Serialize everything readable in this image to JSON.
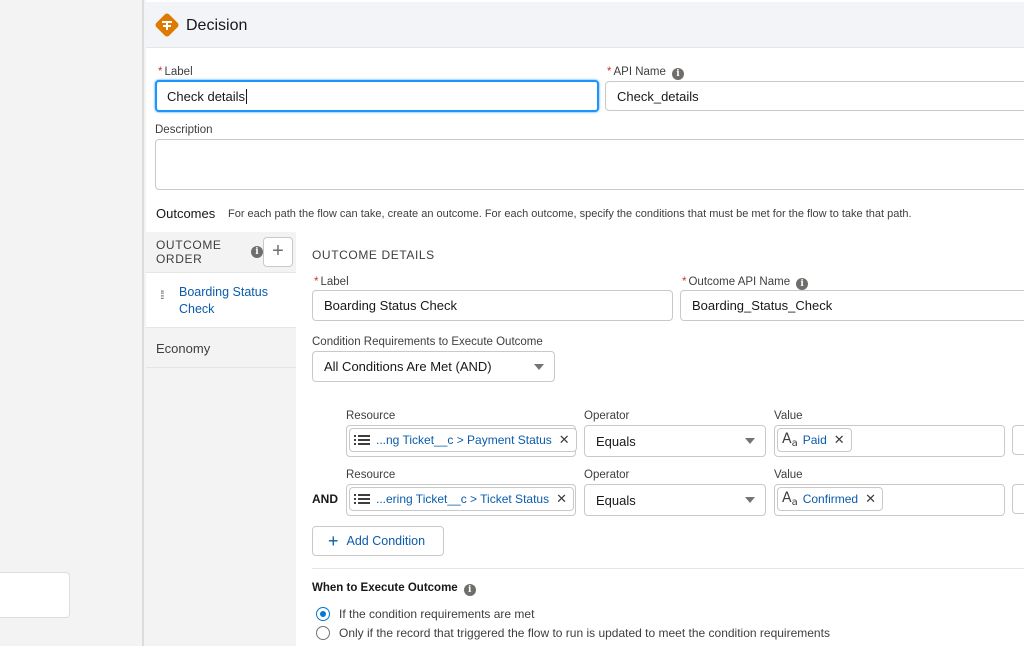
{
  "header": {
    "title": "Decision"
  },
  "form": {
    "label": {
      "label": "Label",
      "value": "Check details"
    },
    "api_name": {
      "label": "API Name",
      "value": "Check_details"
    },
    "description": {
      "label": "Description",
      "value": ""
    }
  },
  "outcomes": {
    "title": "Outcomes",
    "description": "For each path the flow can take, create an outcome. For each outcome, specify the conditions that must be met for the flow to take that path.",
    "order_heading_line1": "OUTCOME",
    "order_heading_line2": "ORDER",
    "items": [
      {
        "label": "Boarding Status Check",
        "active": true
      },
      {
        "label": "Economy",
        "active": false
      }
    ]
  },
  "outcome_details": {
    "heading": "OUTCOME DETAILS",
    "label": {
      "label": "Label",
      "value": "Boarding Status Check"
    },
    "api_name": {
      "label": "Outcome API Name",
      "value": "Boarding_Status_Check"
    },
    "condition_requirements": {
      "label": "Condition Requirements to Execute Outcome",
      "value": "All Conditions Are Met (AND)"
    },
    "conditions": [
      {
        "resource_label": "Resource",
        "resource": "...ng Ticket__c > Payment Status",
        "operator_label": "Operator",
        "operator": "Equals",
        "value_label": "Value",
        "value": "Paid",
        "logic": ""
      },
      {
        "resource_label": "Resource",
        "resource": "...ering Ticket__c > Ticket Status",
        "operator_label": "Operator",
        "operator": "Equals",
        "value_label": "Value",
        "value": "Confirmed",
        "logic": "AND"
      }
    ],
    "add_condition_label": "Add Condition",
    "when_to_execute": {
      "title": "When to Execute Outcome",
      "options": [
        {
          "label": "If the condition requirements are met",
          "selected": true
        },
        {
          "label": "Only if the record that triggered the flow to run is updated to meet the condition requirements",
          "selected": false
        }
      ]
    }
  },
  "colors": {
    "accent": "#0176d3",
    "link": "#0b5cab",
    "decision_icon": "#dd7a01",
    "required": "#c23934"
  }
}
